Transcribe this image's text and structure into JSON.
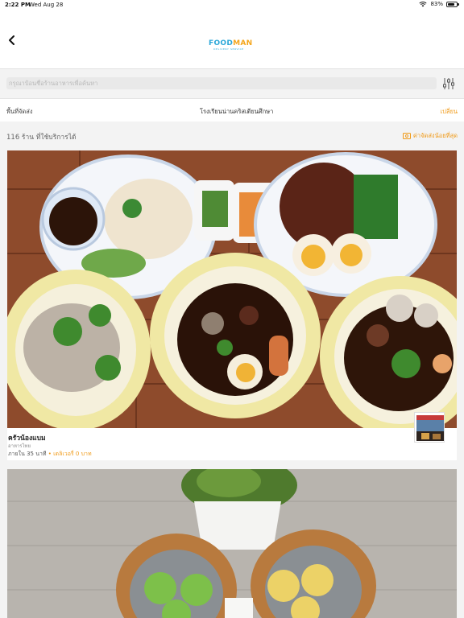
{
  "status": {
    "time": "2:22 PM",
    "date": "Wed Aug 28",
    "battery": "83%",
    "battery_level": 0.83
  },
  "nav": {
    "back_icon": "chevron-left-icon",
    "logo_part1": "FOOD",
    "logo_part2": "MAN",
    "logo_sub": "DELIVERY SERVICE"
  },
  "search": {
    "placeholder": "กรุณาป้อนชื่อร้านอาหารเพื่อค้นหา",
    "filter_icon": "sliders-icon"
  },
  "delivery": {
    "label": "พื้นที่จัดส่ง",
    "value": "โรงเรียนน่านคริสเตียนศึกษา",
    "change": "เปลี่ยน"
  },
  "results": {
    "count_text": "116 ร้าน ที่ใช้บริการได้",
    "sort_label": "ค่าจัดส่งน้อยที่สุด",
    "sort_icon": "money-icon"
  },
  "restaurants": [
    {
      "name": "ครัวน้องแบม",
      "cuisine": "อาหารไทย",
      "time": "ภายใน 35 นาที",
      "separator": "•",
      "fee": "เดลิเวอรี่ 0 บาท"
    }
  ],
  "colors": {
    "accent": "#f09a18",
    "brand_blue": "#2aa7d8"
  }
}
